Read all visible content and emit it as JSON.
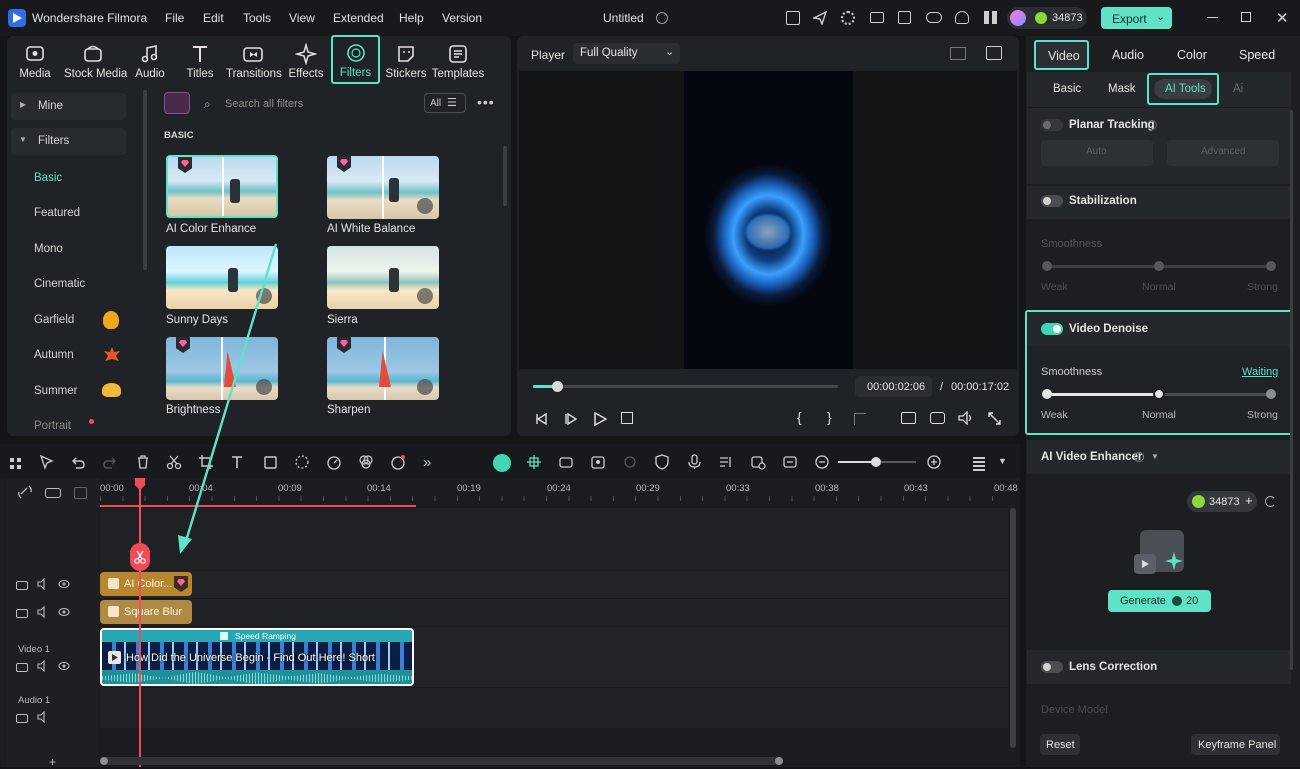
{
  "app": {
    "name": "Wondershare Filmora",
    "project_title": "Untitled",
    "credits": "34873",
    "export_label": "Export"
  },
  "menu": [
    "File",
    "Edit",
    "Tools",
    "View",
    "Extended",
    "Help",
    "Version"
  ],
  "toolbar": [
    "Media",
    "Stock Media",
    "Audio",
    "Titles",
    "Transitions",
    "Effects",
    "Filters",
    "Stickers",
    "Templates"
  ],
  "active_tool": "Filters",
  "sidebar": {
    "mine": "Mine",
    "filters": "Filters",
    "items": [
      "Basic",
      "Featured",
      "Mono",
      "Cinematic",
      "Garfield",
      "Autumn",
      "Summer",
      "Portrait"
    ],
    "active": "Basic"
  },
  "filters_panel": {
    "search_placeholder": "Search all filters",
    "all_label": "All",
    "section": "BASIC",
    "items": [
      "AI Color Enhance",
      "AI White Balance",
      "Sunny Days",
      "Sierra",
      "Brightness",
      "Sharpen"
    ]
  },
  "player": {
    "label": "Player",
    "quality": "Full Quality",
    "current_time": "00:00:02:06",
    "separator": "/",
    "total_time": "00:00:17:02",
    "progress": 0.08
  },
  "right_panel": {
    "tabs": [
      "Video",
      "Audio",
      "Color",
      "Speed"
    ],
    "active_tab": "Video",
    "subtabs": [
      "Basic",
      "Mask",
      "AI Tools",
      "Ai"
    ],
    "active_subtab": "AI Tools",
    "planar_tracking": {
      "label": "Planar Tracking",
      "auto": "Auto",
      "advanced": "Advanced"
    },
    "stabilization": {
      "label": "Stabilization",
      "smoothness": "Smoothness",
      "weak": "Weak",
      "normal": "Normal",
      "strong": "Strong"
    },
    "video_denoise": {
      "label": "Video Denoise",
      "enabled": true,
      "smoothness": "Smoothness",
      "status": "Waiting",
      "weak": "Weak",
      "normal": "Normal",
      "strong": "Strong",
      "level": "Normal"
    },
    "ai_video_enhancer": {
      "label": "AI Video Enhancer",
      "credits": "34873",
      "generate_label": "Generate",
      "generate_cost": "20"
    },
    "lens_correction": {
      "label": "Lens Correction",
      "device_model": "Device Model"
    },
    "reset_label": "Reset",
    "keyframe_label": "Keyframe Panel"
  },
  "timeline": {
    "ruler": [
      "00:00",
      "00:04",
      "00:09",
      "00:14",
      "00:19",
      "00:24",
      "00:29",
      "00:33",
      "00:38",
      "00:43",
      "00:48"
    ],
    "clips": {
      "filter_clip": "AI Color...",
      "effect_clip": "Square Blur",
      "speed_label": "Speed Ramping",
      "video_clip": "How Did the Universe Begin - Find Out Here!  Short"
    },
    "tracks": {
      "video": "Video 1",
      "audio": "Audio 1"
    }
  },
  "colors": {
    "accent": "#5fe2c5",
    "filter_clip": "#b8862f",
    "effect_clip": "#b08a45",
    "playhead": "#f14b5a"
  }
}
